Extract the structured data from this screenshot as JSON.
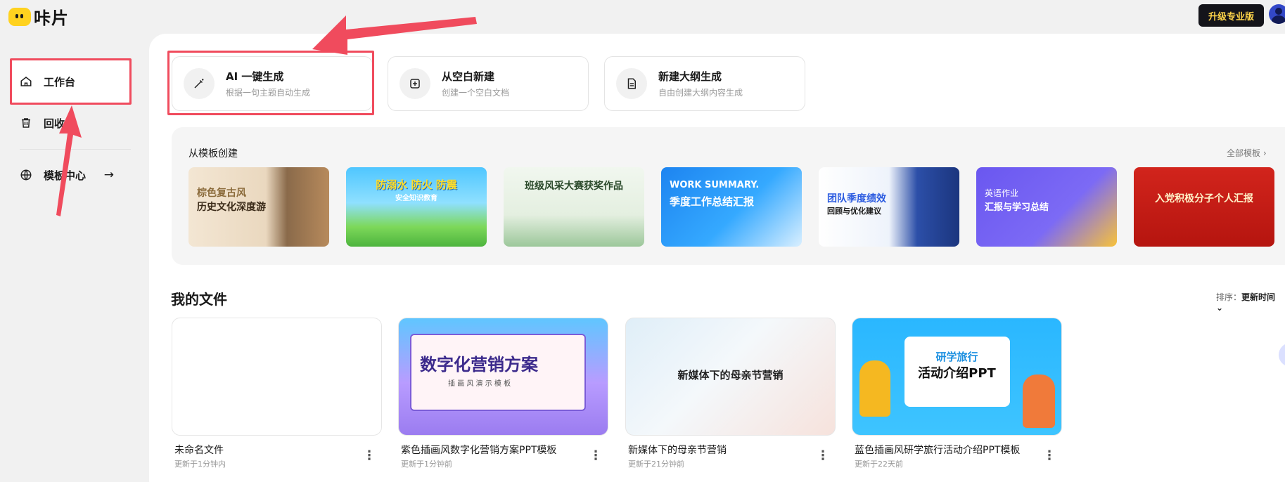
{
  "app": {
    "logo_text": "咔片"
  },
  "header": {
    "upgrade_label": "升级专业版"
  },
  "sidebar": {
    "items": [
      {
        "label": "工作台",
        "icon": "home-icon"
      },
      {
        "label": "回收站",
        "icon": "trash-icon"
      },
      {
        "label": "模板中心",
        "icon": "globe-icon",
        "trailing": "→"
      }
    ]
  },
  "create_cards": [
    {
      "title": "AI 一键生成",
      "subtitle": "根据一句主题自动生成",
      "icon": "magic-wand-icon"
    },
    {
      "title": "从空白新建",
      "subtitle": "创建一个空白文档",
      "icon": "add-square-icon"
    },
    {
      "title": "新建大纲生成",
      "subtitle": "自由创建大纲内容生成",
      "icon": "document-icon"
    }
  ],
  "templates": {
    "section_title": "从模板创建",
    "all_link": "全部模板 ›",
    "items": [
      {
        "line1": "棕色复古风",
        "line2": "历史文化深度游"
      },
      {
        "line1": "防溺水 防火 防震",
        "line2": "安全知识教育"
      },
      {
        "line1": "班级风采大赛获奖作品",
        "line2": ""
      },
      {
        "line1": "WORK SUMMARY.",
        "line2": "季度工作总结汇报"
      },
      {
        "line1": "团队季度绩效",
        "line2": "回顾与优化建议"
      },
      {
        "line1": "英语作业",
        "line2": "汇报与学习总结"
      },
      {
        "line1": "入党积极分子个人汇报",
        "line2": ""
      }
    ]
  },
  "files": {
    "section_title": "我的文件",
    "sort_label": "排序：",
    "sort_value": "更新时间 ⌄",
    "items": [
      {
        "name": "未命名文件",
        "meta": "更新于1分钟内",
        "thumb_text": ""
      },
      {
        "name": "紫色插画风数字化营销方案PPT模板",
        "meta": "更新于1分钟前",
        "thumb_text": "数字化营销方案",
        "thumb_sub": "插 画 风 演 示 模 板"
      },
      {
        "name": "新媒体下的母亲节营销",
        "meta": "更新于21分钟前",
        "thumb_text": "新媒体下的母亲节营销"
      },
      {
        "name": "蓝色插画风研学旅行活动介绍PPT模板",
        "meta": "更新于22天前",
        "thumb_text": "研学旅行",
        "thumb_sub": "活动介绍PPT"
      }
    ]
  },
  "colors": {
    "annotation_red": "#f04b5d",
    "accent_yellow": "#ffd21f"
  }
}
